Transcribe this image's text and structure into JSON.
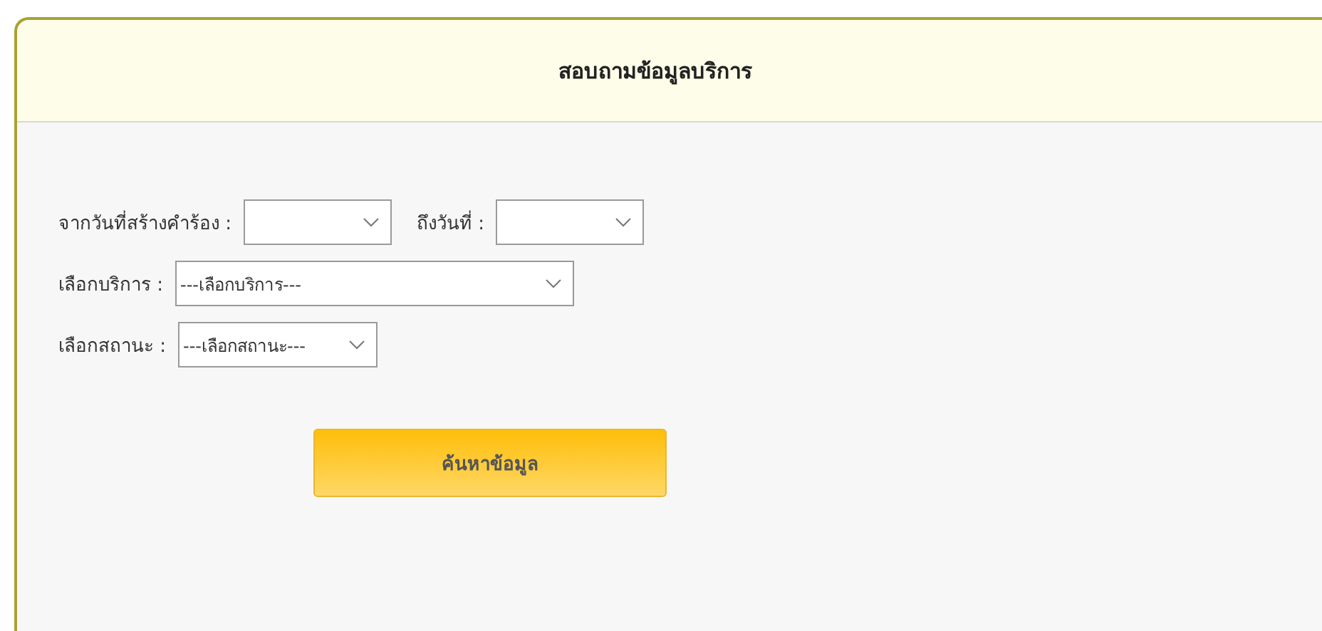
{
  "panel": {
    "title": "สอบถามข้อมูลบริการ"
  },
  "rows": [
    {
      "fields": [
        {
          "label": "จากวันที่สร้างคำร้อง :"
        },
        {
          "label": "ถึงวันที่ :"
        }
      ]
    },
    {
      "fields": [
        {
          "label": "เลือกบริการ :",
          "value": "---เลือกบริการ---"
        }
      ]
    },
    {
      "fields": [
        {
          "label": "เลือกสถานะ :",
          "value": "---เลือกสถานะ---"
        }
      ]
    }
  ],
  "button": {
    "label": "ค้นหาข้อมูล"
  }
}
